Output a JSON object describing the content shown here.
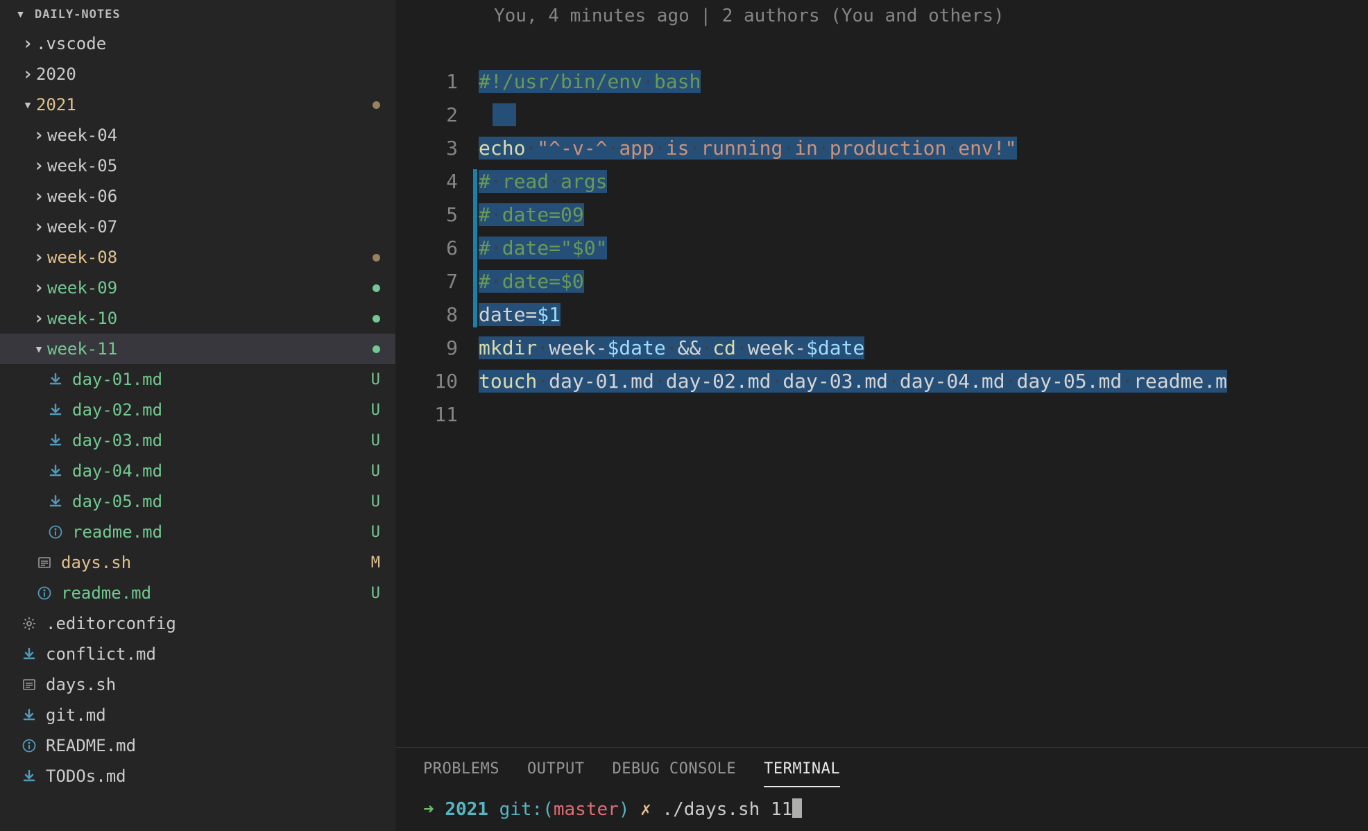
{
  "sidebar": {
    "title": "DAILY-NOTES",
    "items": [
      {
        "name": ".vscode",
        "type": "folder",
        "indent": 1,
        "chevron": "right",
        "color": "folder",
        "status": ""
      },
      {
        "name": "2020",
        "type": "folder",
        "indent": 1,
        "chevron": "right",
        "color": "folder",
        "status": ""
      },
      {
        "name": "2021",
        "type": "folder",
        "indent": 1,
        "chevron": "down",
        "color": "yellow",
        "status": "dot-brown"
      },
      {
        "name": "week-04",
        "type": "folder",
        "indent": 2,
        "chevron": "right",
        "color": "folder",
        "status": ""
      },
      {
        "name": "week-05",
        "type": "folder",
        "indent": 2,
        "chevron": "right",
        "color": "folder",
        "status": ""
      },
      {
        "name": "week-06",
        "type": "folder",
        "indent": 2,
        "chevron": "right",
        "color": "folder",
        "status": ""
      },
      {
        "name": "week-07",
        "type": "folder",
        "indent": 2,
        "chevron": "right",
        "color": "folder",
        "status": ""
      },
      {
        "name": "week-08",
        "type": "folder",
        "indent": 2,
        "chevron": "right",
        "color": "yellow",
        "status": "dot-brown"
      },
      {
        "name": "week-09",
        "type": "folder",
        "indent": 2,
        "chevron": "right",
        "color": "green",
        "status": "dot-green"
      },
      {
        "name": "week-10",
        "type": "folder",
        "indent": 2,
        "chevron": "right",
        "color": "green",
        "status": "dot-green"
      },
      {
        "name": "week-11",
        "type": "folder",
        "indent": 2,
        "chevron": "down",
        "color": "green",
        "status": "dot-green",
        "selected": true
      },
      {
        "name": "day-01.md",
        "type": "file-md",
        "indent": 2,
        "icon": "md-arrow",
        "color": "green",
        "status": "U"
      },
      {
        "name": "day-02.md",
        "type": "file-md",
        "indent": 2,
        "icon": "md-arrow",
        "color": "green",
        "status": "U"
      },
      {
        "name": "day-03.md",
        "type": "file-md",
        "indent": 2,
        "icon": "md-arrow",
        "color": "green",
        "status": "U"
      },
      {
        "name": "day-04.md",
        "type": "file-md",
        "indent": 2,
        "icon": "md-arrow",
        "color": "green",
        "status": "U"
      },
      {
        "name": "day-05.md",
        "type": "file-md",
        "indent": 2,
        "icon": "md-arrow",
        "color": "green",
        "status": "U"
      },
      {
        "name": "readme.md",
        "type": "file-info",
        "indent": 2,
        "icon": "info",
        "color": "green",
        "status": "U"
      },
      {
        "name": "days.sh",
        "type": "file-sh",
        "indent": 1,
        "icon": "sh",
        "color": "yellow",
        "status": "M"
      },
      {
        "name": "readme.md",
        "type": "file-info",
        "indent": 1,
        "icon": "info",
        "color": "green",
        "status": "U"
      },
      {
        "name": ".editorconfig",
        "type": "file",
        "indent": 0,
        "icon": "gear",
        "color": "folder",
        "status": ""
      },
      {
        "name": "conflict.md",
        "type": "file-md",
        "indent": 0,
        "icon": "md-arrow",
        "color": "folder",
        "status": ""
      },
      {
        "name": "days.sh",
        "type": "file-sh",
        "indent": 0,
        "icon": "sh",
        "color": "folder",
        "status": ""
      },
      {
        "name": "git.md",
        "type": "file-md",
        "indent": 0,
        "icon": "md-arrow",
        "color": "folder",
        "status": ""
      },
      {
        "name": "README.md",
        "type": "file-info",
        "indent": 0,
        "icon": "info",
        "color": "folder",
        "status": ""
      },
      {
        "name": "TODOs.md",
        "type": "file-md",
        "indent": 0,
        "icon": "md-arrow",
        "color": "folder",
        "status": ""
      }
    ]
  },
  "editor": {
    "blame": "You, 4 minutes ago | 2 authors (You and others)",
    "diff_start_line": 4,
    "diff_end_line": 8,
    "lines": [
      {
        "n": 1,
        "tokens": [
          [
            "cmt",
            "#!/usr/bin/env"
          ],
          [
            "ws",
            "·"
          ],
          [
            "cmt",
            "bash"
          ]
        ],
        "sel": true
      },
      {
        "n": 2,
        "tokens": [],
        "sel": true,
        "empty_sel": true
      },
      {
        "n": 3,
        "tokens": [
          [
            "cmd",
            "echo"
          ],
          [
            "ws",
            "·"
          ],
          [
            "str",
            "\"^-v-^"
          ],
          [
            "ws",
            "·"
          ],
          [
            "str",
            "app"
          ],
          [
            "ws",
            "·"
          ],
          [
            "str",
            "is"
          ],
          [
            "ws",
            "·"
          ],
          [
            "str",
            "running"
          ],
          [
            "ws",
            "·"
          ],
          [
            "str",
            "in"
          ],
          [
            "ws",
            "·"
          ],
          [
            "str",
            "production"
          ],
          [
            "ws",
            "·"
          ],
          [
            "str",
            "env!\""
          ]
        ],
        "sel": true
      },
      {
        "n": 4,
        "tokens": [
          [
            "cmt",
            "#"
          ],
          [
            "ws",
            "·"
          ],
          [
            "cmt",
            "read"
          ],
          [
            "ws",
            "·"
          ],
          [
            "cmt",
            "args"
          ]
        ],
        "sel": true
      },
      {
        "n": 5,
        "tokens": [
          [
            "cmt",
            "#"
          ],
          [
            "ws",
            "·"
          ],
          [
            "cmt",
            "date=09"
          ]
        ],
        "sel": true
      },
      {
        "n": 6,
        "tokens": [
          [
            "cmt",
            "#"
          ],
          [
            "ws",
            "·"
          ],
          [
            "cmt",
            "date=\"$0\""
          ]
        ],
        "sel": true
      },
      {
        "n": 7,
        "tokens": [
          [
            "cmt",
            "#"
          ],
          [
            "ws",
            "·"
          ],
          [
            "cmt",
            "date=$0"
          ]
        ],
        "sel": true
      },
      {
        "n": 8,
        "tokens": [
          [
            "txt",
            "date="
          ],
          [
            "var",
            "$1"
          ]
        ],
        "sel": true
      },
      {
        "n": 9,
        "tokens": [
          [
            "cmd",
            "mkdir"
          ],
          [
            "ws",
            "·"
          ],
          [
            "txt",
            "week-"
          ],
          [
            "var",
            "$date"
          ],
          [
            "ws",
            "·"
          ],
          [
            "op",
            "&&"
          ],
          [
            "ws",
            "·"
          ],
          [
            "cmd",
            "cd"
          ],
          [
            "ws",
            "·"
          ],
          [
            "txt",
            "week-"
          ],
          [
            "var",
            "$date"
          ]
        ],
        "sel": true
      },
      {
        "n": 10,
        "tokens": [
          [
            "cmd",
            "touch"
          ],
          [
            "ws",
            "·"
          ],
          [
            "txt",
            "day-01.md"
          ],
          [
            "ws",
            "·"
          ],
          [
            "txt",
            "day-02.md"
          ],
          [
            "ws",
            "·"
          ],
          [
            "txt",
            "day-03.md"
          ],
          [
            "ws",
            "·"
          ],
          [
            "txt",
            "day-04.md"
          ],
          [
            "ws",
            "·"
          ],
          [
            "txt",
            "day-05.md"
          ],
          [
            "ws",
            "·"
          ],
          [
            "txt",
            "readme.m"
          ]
        ],
        "sel": true
      },
      {
        "n": 11,
        "tokens": [],
        "sel": false
      }
    ]
  },
  "panel": {
    "tabs": [
      "PROBLEMS",
      "OUTPUT",
      "DEBUG CONSOLE",
      "TERMINAL"
    ],
    "active_tab": "TERMINAL",
    "terminal": {
      "arrow": "➜",
      "path": "2021",
      "git_label": "git:(",
      "branch": "master",
      "git_close": ")",
      "dirty": "✗",
      "command": "./days.sh 11"
    }
  },
  "icons": {
    "md-arrow": "⬇",
    "info": "ⓘ",
    "sh": "▤",
    "gear": "⚙"
  }
}
